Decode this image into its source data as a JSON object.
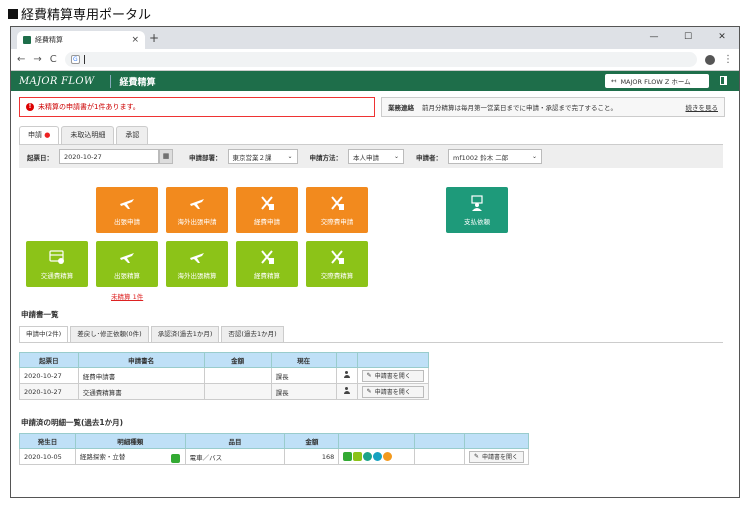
{
  "page_heading": "経費精算専用ポータル",
  "browser": {
    "tab_title": "経費精算",
    "close_glyph": "×",
    "new_tab_glyph": "+",
    "minimize_glyph": "—",
    "maximize_glyph": "☐",
    "window_close_glyph": "✕",
    "back_glyph": "←",
    "forward_glyph": "→",
    "reload_glyph": "C",
    "kebab_glyph": "⋮",
    "search_engine_glyph": "G"
  },
  "header": {
    "logo": "MAJOR FLOW",
    "app_title": "経費精算",
    "portal_button": "MAJOR FLOW Z ホーム",
    "portal_arrow": "↤"
  },
  "alert": {
    "icon": "!",
    "text": "未精算の申請書が1件あります。"
  },
  "notice": {
    "label": "業務連絡",
    "message": "前月分精算は毎月第一営業日までに申請・承認まで完了すること。",
    "link": "続きを見る"
  },
  "tabs": [
    {
      "label": "申請",
      "dot": "●"
    },
    {
      "label": "未取込明細"
    },
    {
      "label": "承認"
    }
  ],
  "filters": {
    "date_label": "起票日：",
    "date_value": "2020-10-27",
    "calendar_icon": "▦",
    "dept_label": "申請部署：",
    "dept_value": "東京営業２課",
    "method_label": "申請方法：",
    "method_value": "本人申請",
    "applicant_label": "申請者：",
    "applicant_value": "mf1002  鈴木  二郎",
    "chevron": "⌄"
  },
  "tiles": {
    "row1": [
      "出張申請",
      "海外出張申請",
      "経費申請",
      "交際費申請"
    ],
    "row2": [
      "交通費精算",
      "出張精算",
      "海外出張精算",
      "経費精算",
      "交際費精算"
    ],
    "payment": "支払依頼",
    "unsettled_link": "未精算 1件"
  },
  "application_list": {
    "title": "申請書一覧",
    "subtabs": [
      "申請中(2件)",
      "差戻し･修正依頼(0件)",
      "承認済(過去1か月)",
      "否認(過去1か月)"
    ],
    "columns": [
      "起票日",
      "申請書名",
      "金額",
      "現在",
      "",
      ""
    ],
    "rows": [
      {
        "date": "2020-10-27",
        "name": "経費申請書",
        "amount": "",
        "status": "課長",
        "button": "申請書を開く"
      },
      {
        "date": "2020-10-27",
        "name": "交通費精算書",
        "amount": "",
        "status": "課長",
        "button": "申請書を開く"
      }
    ]
  },
  "detail_list": {
    "title": "申請済の明細一覧(過去1か月)",
    "columns": [
      "発生日",
      "明細種類",
      "品目",
      "金額",
      "",
      "",
      ""
    ],
    "rows": [
      {
        "date": "2020-10-05",
        "type": "経路探索・立替",
        "item": "電車／バス",
        "amount": "168",
        "button": "申請書を開く"
      }
    ]
  },
  "colors": {
    "brand_green": "#1e6e4a",
    "tile_orange": "#f28a1e",
    "tile_lime": "#8cc318",
    "tile_teal": "#1e9a7a",
    "alert_red": "#e33333",
    "table_header": "#bfe0f7"
  }
}
